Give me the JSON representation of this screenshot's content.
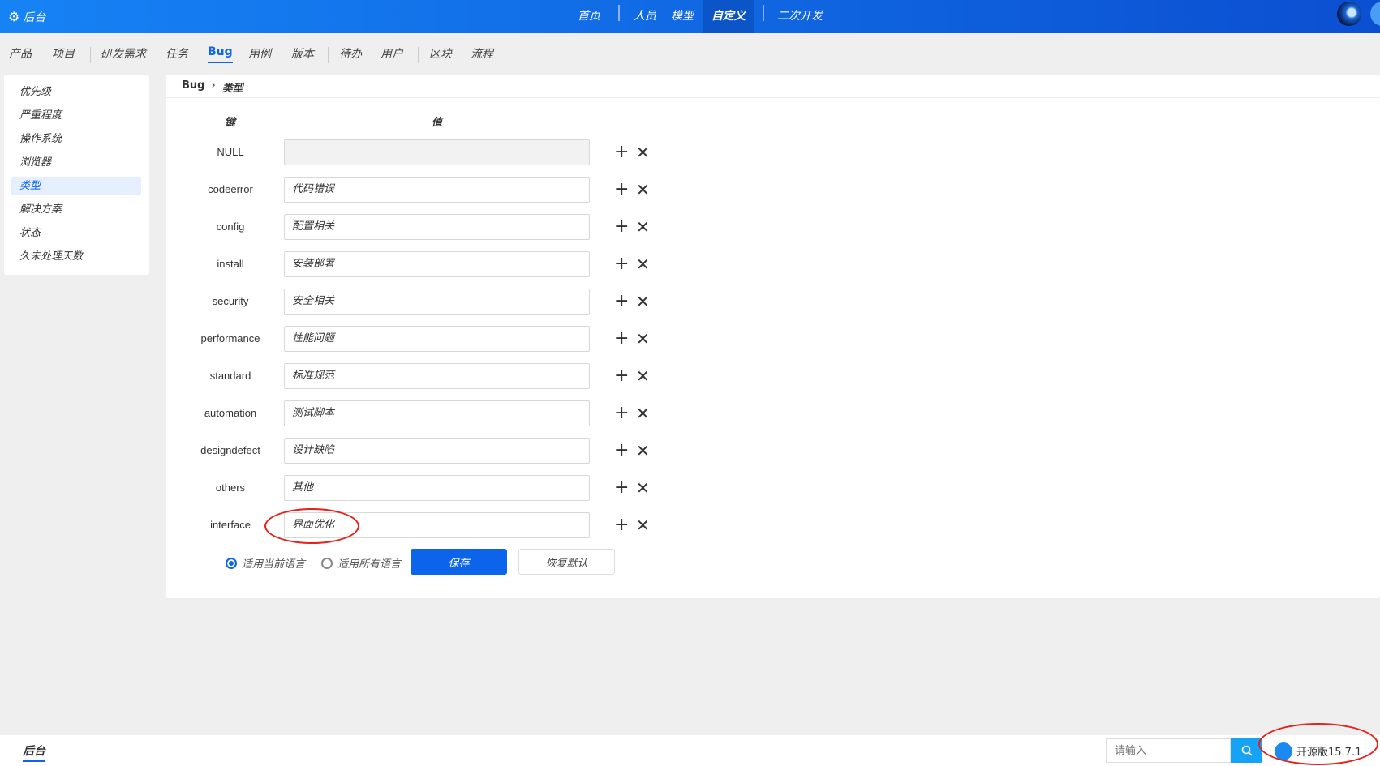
{
  "header": {
    "brand": "后台",
    "nav": [
      "首页",
      "人员",
      "模型",
      "自定义",
      "二次开发"
    ],
    "active_nav": "自定义"
  },
  "tabs": [
    "产品",
    "项目",
    "研发需求",
    "任务",
    "Bug",
    "用例",
    "版本",
    "待办",
    "用户",
    "区块",
    "流程"
  ],
  "active_tab": "Bug",
  "sidebar": {
    "items": [
      "优先级",
      "严重程度",
      "操作系统",
      "浏览器",
      "类型",
      "解决方案",
      "状态",
      "久未处理天数"
    ],
    "active": "类型"
  },
  "breadcrumb": {
    "parent": "Bug",
    "sep": "›",
    "current": "类型"
  },
  "table": {
    "key_header": "键",
    "value_header": "值",
    "rows": [
      {
        "key": "NULL",
        "value": ""
      },
      {
        "key": "codeerror",
        "value": "代码错误"
      },
      {
        "key": "config",
        "value": "配置相关"
      },
      {
        "key": "install",
        "value": "安装部署"
      },
      {
        "key": "security",
        "value": "安全相关"
      },
      {
        "key": "performance",
        "value": "性能问题"
      },
      {
        "key": "standard",
        "value": "标准规范"
      },
      {
        "key": "automation",
        "value": "测试脚本"
      },
      {
        "key": "designdefect",
        "value": "设计缺陷"
      },
      {
        "key": "others",
        "value": "其他"
      },
      {
        "key": "interface",
        "value": "界面优化"
      }
    ]
  },
  "options": {
    "current_lang": "适用当前语言",
    "all_lang": "适用所有语言",
    "save": "保存",
    "reset": "恢复默认"
  },
  "footer": {
    "label": "后台",
    "search_placeholder": "请输入",
    "version": "开源版15.7.1"
  },
  "colors": {
    "primary": "#0c64eb",
    "annotation": "#e8201a"
  }
}
